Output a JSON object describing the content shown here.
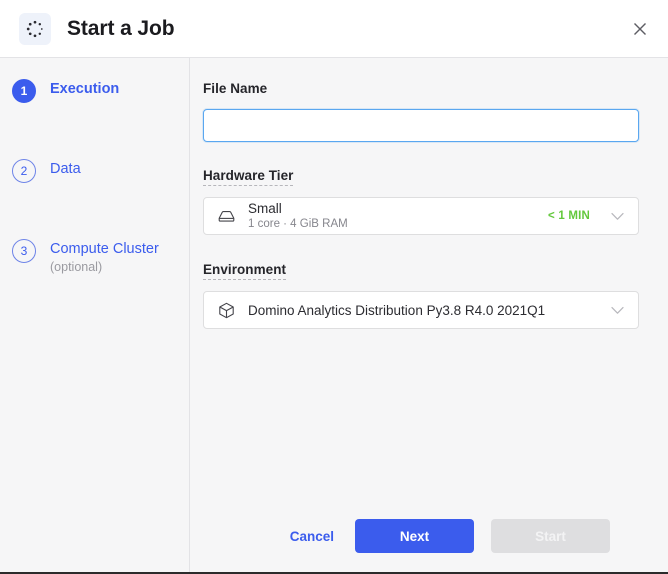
{
  "header": {
    "title": "Start a Job",
    "icon": "job-spinner-icon",
    "close_label": "×"
  },
  "sidebar": {
    "steps": [
      {
        "number": "1",
        "label": "Execution",
        "sub": "",
        "state": "active"
      },
      {
        "number": "2",
        "label": "Data",
        "sub": "",
        "state": "inactive"
      },
      {
        "number": "3",
        "label": "Compute Cluster",
        "sub": "(optional)",
        "state": "inactive"
      }
    ]
  },
  "main": {
    "file_name": {
      "label": "File Name",
      "value": "",
      "placeholder": ""
    },
    "hardware_tier": {
      "label": "Hardware Tier",
      "icon": "server-icon",
      "name": "Small",
      "spec": "1 core · 4 GiB RAM",
      "duration_badge": "< 1 MIN",
      "chevron": "chevron-down-icon"
    },
    "environment": {
      "label": "Environment",
      "icon": "cube-icon",
      "value": "Domino Analytics Distribution Py3.8 R4.0 2021Q1",
      "chevron": "chevron-down-icon"
    }
  },
  "footer": {
    "cancel_label": "Cancel",
    "next_label": "Next",
    "start_label": "Start"
  },
  "colors": {
    "accent_blue": "#3b5ced",
    "badge_green": "#63c83c",
    "focus_blue": "#5aa7f0",
    "panel_bg": "#f6f6f7",
    "disabled_gray": "#dedee0"
  }
}
